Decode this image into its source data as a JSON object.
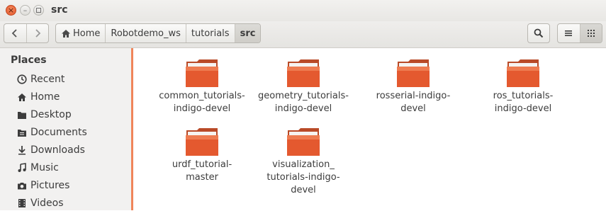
{
  "window": {
    "title": "src"
  },
  "toolbar": {
    "breadcrumbs": [
      "Home",
      "Robotdemo_ws",
      "tutorials",
      "src"
    ]
  },
  "sidebar": {
    "heading": "Places",
    "items": [
      {
        "label": "Recent",
        "icon": "clock-icon"
      },
      {
        "label": "Home",
        "icon": "home-icon"
      },
      {
        "label": "Desktop",
        "icon": "desktop-folder-icon"
      },
      {
        "label": "Documents",
        "icon": "documents-icon"
      },
      {
        "label": "Downloads",
        "icon": "downloads-icon"
      },
      {
        "label": "Music",
        "icon": "music-icon"
      },
      {
        "label": "Pictures",
        "icon": "camera-icon"
      },
      {
        "label": "Videos",
        "icon": "film-icon"
      }
    ]
  },
  "files": [
    {
      "line1": "common_tutorials-",
      "line2": "indigo-devel",
      "line3": ""
    },
    {
      "line1": "geometry_tutorials-",
      "line2": "indigo-devel",
      "line3": ""
    },
    {
      "line1": "rosserial-indigo-",
      "line2": "devel",
      "line3": ""
    },
    {
      "line1": "ros_tutorials-",
      "line2": "indigo-devel",
      "line3": ""
    },
    {
      "line1": "urdf_tutorial-",
      "line2": "master",
      "line3": ""
    },
    {
      "line1": "visualization_",
      "line2": "tutorials-indigo-",
      "line3": "devel"
    }
  ],
  "colors": {
    "accent": "#f0855a",
    "folder_body": "#e4592f",
    "folder_tab": "#f29a73",
    "close_button": "#e3582a"
  }
}
